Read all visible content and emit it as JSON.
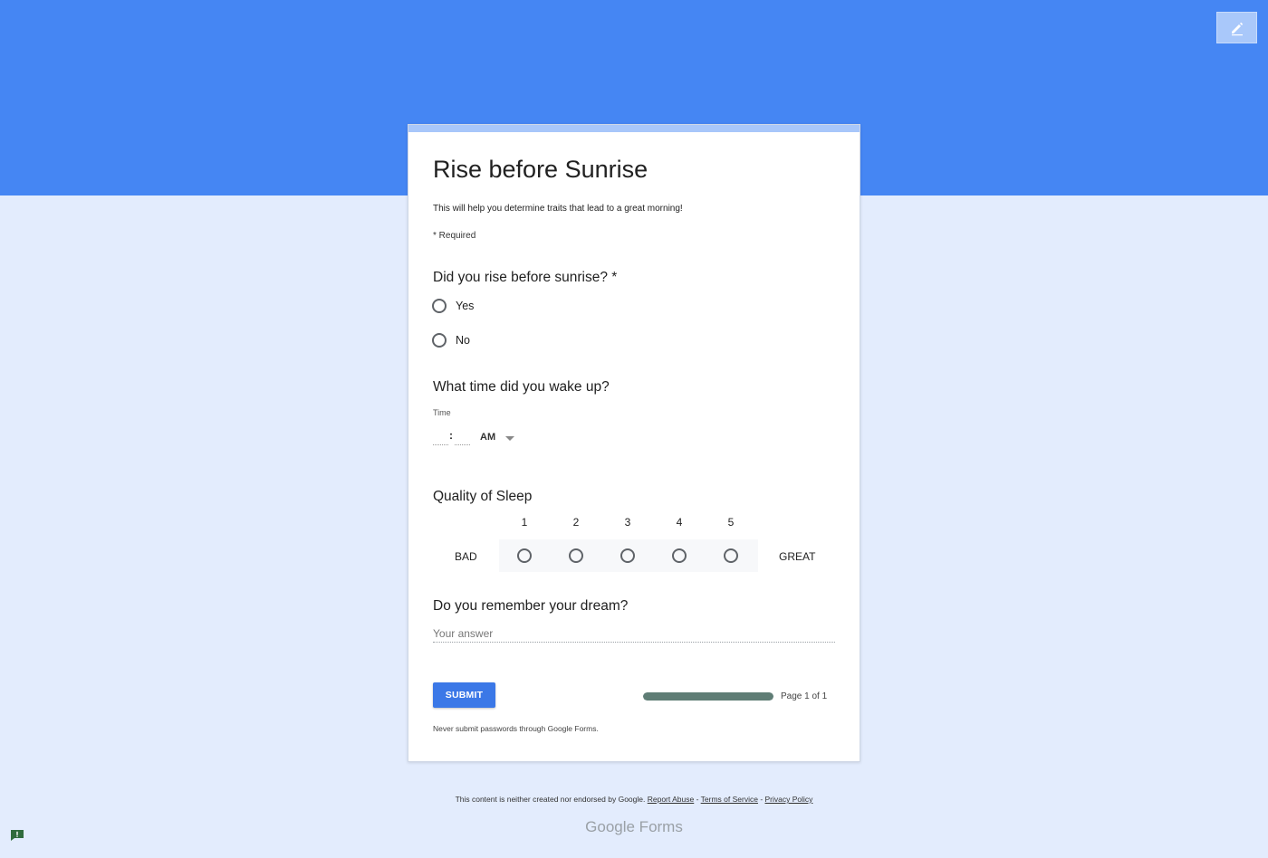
{
  "header": {
    "band_color": "#4586f3",
    "edit_icon": "pencil-icon"
  },
  "form": {
    "title": "Rise before Sunrise",
    "description": "This will help you determine traits that lead to a great morning!",
    "required_note": "* Required",
    "accent": "#a8c7fa"
  },
  "questions": {
    "q1": {
      "title": "Did you rise before sunrise? *",
      "options": [
        "Yes",
        "No"
      ]
    },
    "q2": {
      "title": "What time did you wake up?",
      "time_label": "Time",
      "hour_value": "",
      "minute_value": "",
      "separator": ":",
      "ampm": "AM"
    },
    "q3": {
      "title": "Quality of Sleep",
      "scale": [
        "1",
        "2",
        "3",
        "4",
        "5"
      ],
      "low_label": "BAD",
      "high_label": "GREAT"
    },
    "q4": {
      "title": "Do you remember your dream?",
      "placeholder": "Your answer",
      "value": ""
    }
  },
  "actions": {
    "submit_label": "SUBMIT",
    "submit_color": "#3b78e7"
  },
  "progress": {
    "fraction": 1.0,
    "page_text": "Page 1 of 1"
  },
  "notice": "Never submit passwords through Google Forms.",
  "footer": {
    "text": "This content is neither created nor endorsed by Google.",
    "report_abuse": "Report Abuse",
    "sep1": " - ",
    "terms": "Terms of Service",
    "sep2": " - ",
    "privacy": "Privacy Policy",
    "brand": "Google Forms",
    "report_icon": "report-flag-icon"
  }
}
